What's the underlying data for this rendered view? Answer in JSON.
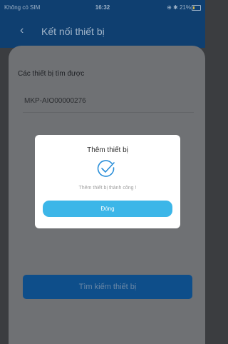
{
  "status_bar": {
    "carrier": "Không có SIM",
    "time": "16:32",
    "battery": "21%",
    "battery_level": 0.21
  },
  "header": {
    "back_icon": "chevron-left-icon",
    "title": "Kết nối thiết bị"
  },
  "main": {
    "section_label": "Các thiết bị tìm được",
    "devices": [
      "MKP-AIO00000276"
    ],
    "search_button": "Tìm kiếm thiết bị"
  },
  "dialog": {
    "title": "Thêm thiết bị",
    "icon": "check-circle-icon",
    "message": "Thêm thiết bị  thành công !",
    "close_button": "Đóng"
  },
  "colors": {
    "header_bg": "#0f3f70",
    "accent": "#3cb6e8",
    "check": "#2b8fd9"
  }
}
